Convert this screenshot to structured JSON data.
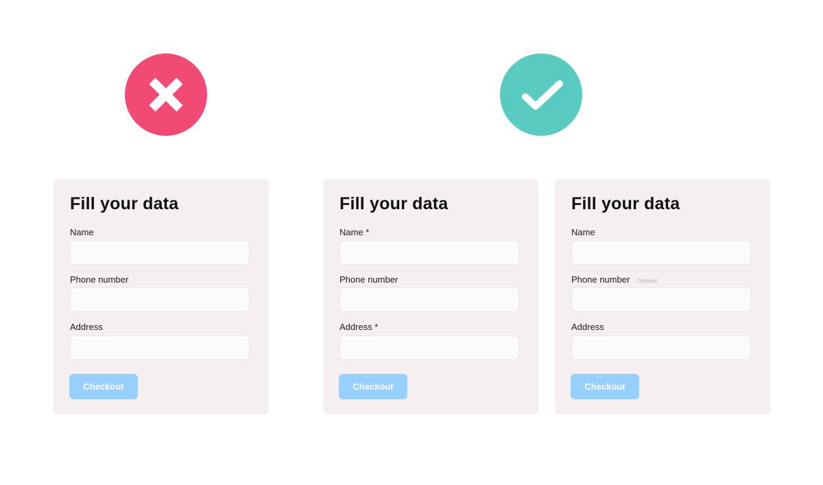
{
  "badges": {
    "bad": {
      "icon": "close-icon",
      "color": "#F14A75"
    },
    "good": {
      "icon": "check-icon",
      "color": "#5ACBC1"
    }
  },
  "cards": [
    {
      "title": "Fill your data",
      "fields": [
        {
          "label": "Name",
          "value": ""
        },
        {
          "label": "Phone number",
          "value": ""
        },
        {
          "label": "Address",
          "value": ""
        }
      ],
      "button": "Checkout"
    },
    {
      "title": "Fill your data",
      "fields": [
        {
          "label": "Name *",
          "value": ""
        },
        {
          "label": "Phone number",
          "value": ""
        },
        {
          "label": "Address *",
          "value": ""
        }
      ],
      "button": "Checkout"
    },
    {
      "title": "Fill your data",
      "fields": [
        {
          "label": "Name",
          "value": ""
        },
        {
          "label": "Phone number",
          "tag": "Optional",
          "value": ""
        },
        {
          "label": "Address",
          "value": ""
        }
      ],
      "button": "Checkout"
    }
  ],
  "colors": {
    "card_bg": "#F5EFF1",
    "button_bg": "#97CFFD",
    "input_bg": "#FBFBFB"
  }
}
